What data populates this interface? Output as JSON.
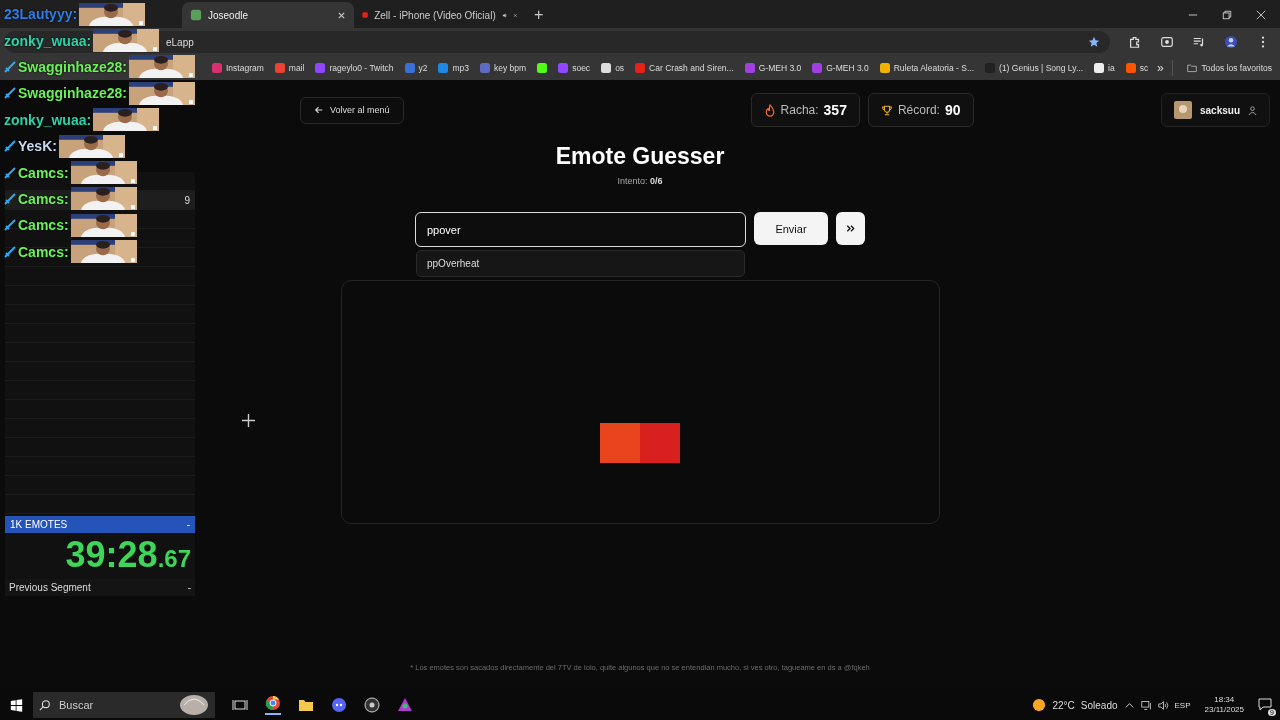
{
  "browser": {
    "tabs": [
      {
        "title": "Joseodle",
        "selected": true,
        "audio": false
      },
      {
        "title": "Zell - iPhone (Video Oficial)",
        "selected": false,
        "audio": true
      }
    ],
    "new_tab": "+",
    "address": "eLapp",
    "bookmarks": [
      {
        "label": "Instagram",
        "color": "#d6306f"
      },
      {
        "label": "mail",
        "color": "#ea4335"
      },
      {
        "label": "rageylo0 - Twitch",
        "color": "#9146ff"
      },
      {
        "label": "y2",
        "color": "#3b6fd8"
      },
      {
        "label": "mp3",
        "color": "#1e88e5"
      },
      {
        "label": "key bpm",
        "color": "#5c6bc0"
      },
      {
        "color": "#53fc18"
      },
      {
        "label": "soec",
        "color": "#9146ff"
      },
      {
        "label": "os",
        "color": "#dddddd"
      },
      {
        "label": "Car Crash and Siren...",
        "color": "#e62117"
      },
      {
        "label": "G-MEH 3.0",
        "color": "#a040e0"
      },
      {
        "label": "G-MEH 3.0",
        "color": "#a040e0"
      },
      {
        "label": "Ruleta Aleatoria - S...",
        "color": "#f0b400"
      },
      {
        "label": "(1) Genius | Song Ly...",
        "color": "#222222"
      },
      {
        "label": "ia",
        "color": "#eeeeee"
      },
      {
        "label": "sc",
        "color": "#ff5500"
      }
    ],
    "more": "»",
    "all_bookmarks": "Todos los favoritos"
  },
  "chat": [
    {
      "user": "23Lautyyy:",
      "color": "#2f7ee6",
      "badge": false
    },
    {
      "user": "zonky_wuaa:",
      "color": "#2ed3a8",
      "badge": false
    },
    {
      "user": "Swagginhaze28:",
      "color": "#6cf05a",
      "badge": true
    },
    {
      "user": "Swagginhaze28:",
      "color": "#6cf05a",
      "badge": true
    },
    {
      "user": "zonky_wuaa:",
      "color": "#2ed3a8",
      "badge": false
    },
    {
      "user": "YesK:",
      "color": "#c9d8f0",
      "badge": true
    },
    {
      "user": "Camcs:",
      "color": "#6cf05a",
      "badge": true
    },
    {
      "user": "Camcs:",
      "color": "#6cf05a",
      "badge": true
    },
    {
      "user": "Camcs:",
      "color": "#6cf05a",
      "badge": true
    },
    {
      "user": "Camcs:",
      "color": "#6cf05a",
      "badge": true
    }
  ],
  "splits": {
    "row_value": "9",
    "title": "1K EMOTES",
    "title_value": "-",
    "timer_main": "39:28",
    "timer_fraction": ".67",
    "previous_label": "Previous Segment",
    "previous_value": "-"
  },
  "game": {
    "back": "Volver al menú",
    "streak_label": "Racha:",
    "streak": "357",
    "record_label": "Récord:",
    "record": "90",
    "user": "sacksuu",
    "title": "Emote Guesser",
    "attempt_label": "Intento:",
    "attempt": "0/6",
    "guess": "ppover",
    "submit": "Enviar",
    "suggestions": [
      "ppOverheat"
    ],
    "footer": "* Los emotes son sacados directamente del 7TV de lolo, quite algunos que no se entendian mucho, si ves otro, tagueame en ds a @fqkeh"
  },
  "taskbar": {
    "search": "Buscar",
    "temperature": "22°C",
    "weather": "Soleado",
    "language": "ESP",
    "time": "18:34",
    "date": "23/11/2025",
    "notifications": "9"
  }
}
